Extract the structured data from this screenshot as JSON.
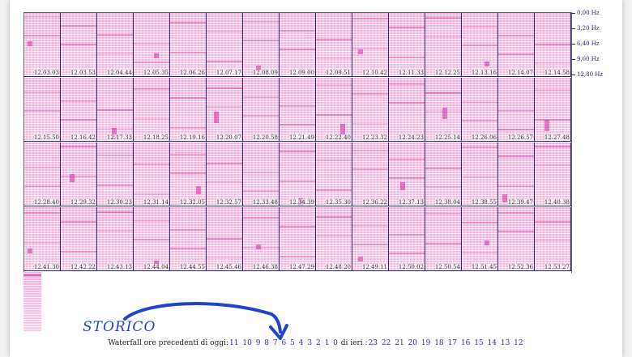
{
  "frequency_labels": [
    "0,00 Hz",
    "3,20 Hz",
    "6,40 Hz",
    "9,60 Hz",
    "12,80 Hz"
  ],
  "rows": [
    [
      "12.03.03",
      "12.03.53",
      "12.04.44",
      "12.05.35",
      "12.06.26",
      "12.07.17",
      "12.08.09",
      "12.09.00",
      "12.09.51",
      "12.10.42",
      "12.11.33",
      "12.12.25",
      "12.13.16",
      "12.14.07",
      "12.14.58"
    ],
    [
      "12.15.50",
      "12.16.42",
      "12.17.33",
      "12.18.25",
      "12.19.16",
      "12.20.07",
      "12.20.58",
      "12.21.49",
      "12.22.40",
      "12.23.32",
      "12.24.23",
      "12.25.14",
      "12.26.06",
      "12.26.57",
      "12.27.48"
    ],
    [
      "12.28.40",
      "12.29.32",
      "12.30.23",
      "12.31.14",
      "12.32.05",
      "12.32.57",
      "12.33.48",
      "12.34.39",
      "12.35.30",
      "12.36.22",
      "12.37.13",
      "12.38.04",
      "12.38.55",
      "12.39.47",
      "12.40.38"
    ],
    [
      "12.41.30",
      "12.42.22",
      "12.43.13",
      "12.44.04",
      "12.44.55",
      "12.45.46",
      "12.46.38",
      "12.47.29",
      "12.48.20",
      "12.49.11",
      "12.50.02",
      "12.50.54",
      "12.51.45",
      "12.52.36",
      "12.53.27"
    ]
  ],
  "annotation": {
    "text": "STORICO",
    "color": "#2244cc"
  },
  "footer": {
    "today_label": "Waterfall ore precedenti di oggi:",
    "today_hours": [
      "11",
      "10",
      "9",
      "8",
      "7",
      "6",
      "5",
      "4",
      "3",
      "2",
      "1",
      "0"
    ],
    "yesterday_label": "di ieri :",
    "yesterday_hours": [
      "23",
      "22",
      "21",
      "20",
      "19",
      "18",
      "17",
      "16",
      "15",
      "14",
      "13",
      "12"
    ]
  },
  "colors": {
    "waterfall_tint": "#f6c8e8",
    "waterfall_peak": "#c81e8c",
    "link": "#2b2baa"
  }
}
